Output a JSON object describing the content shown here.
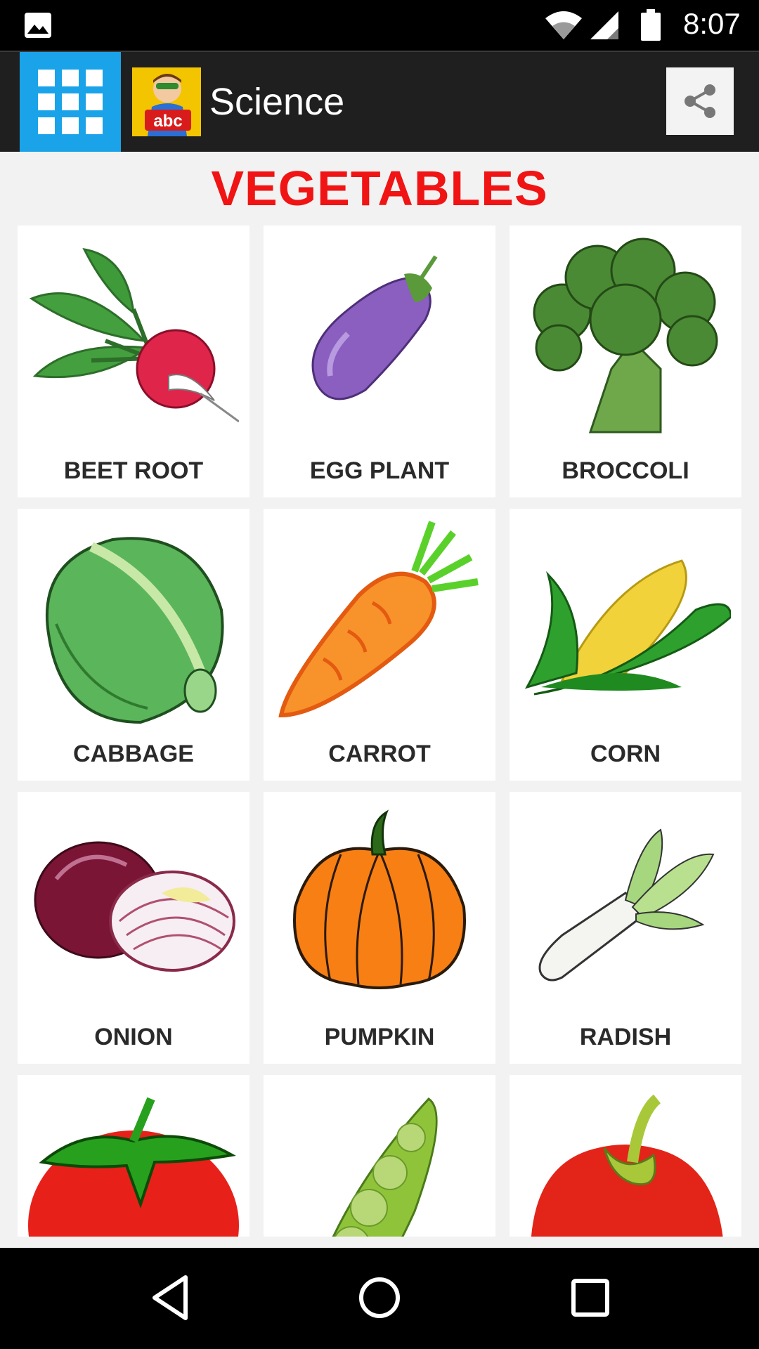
{
  "status_bar": {
    "time": "8:07",
    "icons": [
      "gallery-icon",
      "wifi-icon",
      "signal-icon",
      "battery-icon"
    ]
  },
  "app_bar": {
    "title": "Science",
    "logo_text": "abc",
    "menu_icon": "grid-icon",
    "share_icon": "share-icon",
    "accent_color": "#1aa3e8"
  },
  "section": {
    "title": "VEGETABLES",
    "title_color": "#f01414"
  },
  "items": [
    {
      "label": "BEET ROOT",
      "icon": "beetroot-icon"
    },
    {
      "label": "EGG PLANT",
      "icon": "eggplant-icon"
    },
    {
      "label": "BROCCOLI",
      "icon": "broccoli-icon"
    },
    {
      "label": "CABBAGE",
      "icon": "cabbage-icon"
    },
    {
      "label": "CARROT",
      "icon": "carrot-icon"
    },
    {
      "label": "CORN",
      "icon": "corn-icon"
    },
    {
      "label": "ONION",
      "icon": "onion-icon"
    },
    {
      "label": "PUMPKIN",
      "icon": "pumpkin-icon"
    },
    {
      "label": "RADISH",
      "icon": "radish-icon"
    },
    {
      "label": "",
      "icon": "tomato-icon"
    },
    {
      "label": "",
      "icon": "peas-icon"
    },
    {
      "label": "",
      "icon": "bell-pepper-icon"
    }
  ],
  "nav_bar": {
    "buttons": [
      "back-icon",
      "home-icon",
      "recents-icon"
    ]
  }
}
